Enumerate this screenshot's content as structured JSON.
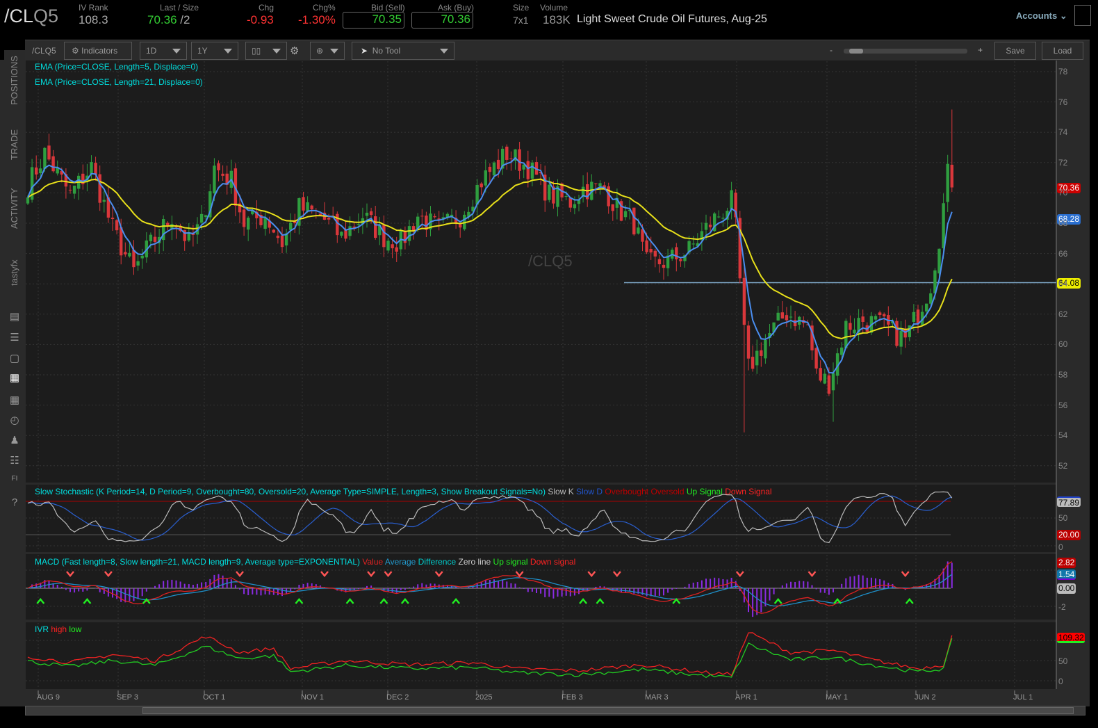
{
  "header": {
    "symbol_main": "/CL",
    "symbol_suffix": "Q5",
    "iv_rank_label": "IV Rank",
    "iv_rank": "108.3",
    "last_label": "Last / Size",
    "last": "70.36",
    "size": "/2",
    "chg_label": "Chg",
    "chg": "-0.93",
    "chgpct_label": "Chg%",
    "chgpct": "-1.30%",
    "bid_label": "Bid (Sell)",
    "bid": "70.35",
    "ask_label": "Ask (Buy)",
    "ask": "70.36",
    "size_label": "Size",
    "size_val": "7x1",
    "volume_label": "Volume",
    "volume": "183K",
    "description": "Light Sweet Crude Oil Futures, Aug-25",
    "accounts": "Accounts"
  },
  "sidebar": {
    "tabs": [
      "POSITIONS",
      "TRADE",
      "ACTIVITY",
      "tastyfx"
    ],
    "icons": [
      "news-icon",
      "list-icon",
      "tv-icon",
      "chart-icon",
      "grid-icon",
      "clock-icon",
      "community-icon",
      "calendar-icon",
      "fi-icon",
      "help-icon"
    ]
  },
  "toolbar": {
    "symbol": "/CLQ5",
    "indicators": "Indicators",
    "interval": "1D",
    "range": "1Y",
    "tool": "No Tool",
    "minus": "-",
    "plus": "+",
    "save": "Save",
    "load": "Load"
  },
  "studies": {
    "ema5": "EMA (Price=CLOSE, Length=5, Displace=0)",
    "ema21": "EMA (Price=CLOSE, Length=21, Displace=0)",
    "watermark": "/CLQ5",
    "stoch": "Slow Stochastic (K Period=14, D Period=9, Overbought=80, Oversold=20, Average Type=SIMPLE, Length=3, Show Breakout Signals=No)",
    "stoch_legend": [
      "Slow K",
      "Slow D",
      "Overbought",
      "Oversold",
      "Up Signal",
      "Down Signal"
    ],
    "macd": "MACD (Fast length=8, Slow length=21, MACD length=9, Average type=EXPONENTIAL)",
    "macd_legend": [
      "Value",
      "Average",
      "Difference",
      "Zero line",
      "Up signal",
      "Down signal"
    ],
    "ivr": "IVR",
    "ivr_legend": [
      "high",
      "low"
    ]
  },
  "colors": {
    "up": "#2f9e3f",
    "down": "#d9373b",
    "ema5": "#4a8ef0",
    "ema21": "#e8e01a"
  },
  "chart_data": {
    "type": "candlestick",
    "price_axis": {
      "ticks": [
        "78",
        "76",
        "74",
        "72",
        "70",
        "68",
        "66",
        "64",
        "62",
        "60",
        "58",
        "56",
        "54",
        "52"
      ],
      "range": [
        52,
        78
      ]
    },
    "x_ticks": [
      "AUG 9",
      "SEP 3",
      "OCT 1",
      "NOV 1",
      "DEC 2",
      "2025",
      "FEB 3",
      "MAR 3",
      "APR 1",
      "MAY 1",
      "JUN 2",
      "JUL 1"
    ],
    "bars": 219,
    "close_anchors": [
      [
        0,
        70.5
      ],
      [
        4,
        72.6
      ],
      [
        10,
        69.9
      ],
      [
        15,
        71.7
      ],
      [
        20,
        67.6
      ],
      [
        25,
        64.8
      ],
      [
        28,
        66.2
      ],
      [
        34,
        68.5
      ],
      [
        38,
        66.7
      ],
      [
        41,
        68
      ],
      [
        44,
        71.7
      ],
      [
        48,
        70.8
      ],
      [
        51,
        68
      ],
      [
        56,
        68.5
      ],
      [
        60,
        66.7
      ],
      [
        64,
        69
      ],
      [
        69,
        68.5
      ],
      [
        74,
        67.1
      ],
      [
        79,
        68.5
      ],
      [
        84,
        67.1
      ],
      [
        88,
        66.7
      ],
      [
        92,
        68.5
      ],
      [
        97,
        67.6
      ],
      [
        102,
        68.5
      ],
      [
        107,
        70.8
      ],
      [
        113,
        72.6
      ],
      [
        118,
        71.7
      ],
      [
        123,
        69.9
      ],
      [
        128,
        69.4
      ],
      [
        131,
        70.3
      ],
      [
        136,
        70.3
      ],
      [
        139,
        69
      ],
      [
        143,
        68
      ],
      [
        146,
        65.3
      ],
      [
        151,
        65.5
      ],
      [
        156,
        66.2
      ],
      [
        161,
        68
      ],
      [
        166,
        69.4
      ],
      [
        167,
        67.6
      ],
      [
        169,
        60.7
      ],
      [
        170,
        58.4
      ],
      [
        174,
        60.3
      ],
      [
        179,
        62.1
      ],
      [
        184,
        61.2
      ],
      [
        186,
        58
      ],
      [
        189,
        57.5
      ],
      [
        193,
        61.2
      ],
      [
        197,
        61.6
      ],
      [
        202,
        61.2
      ],
      [
        207,
        60.3
      ],
      [
        210,
        62.1
      ],
      [
        213,
        64
      ],
      [
        215,
        67.1
      ],
      [
        217,
        71.2
      ],
      [
        218,
        70.36
      ]
    ],
    "hline": 64.08,
    "price_tags": {
      "last": "70.36",
      "ema5": "68.28",
      "level": "64.08"
    },
    "stoch_axis": [
      "50",
      "0"
    ],
    "stoch_tags": {
      "k": "77.89",
      "oversold": "20.00"
    },
    "macd_axis": [
      "-2"
    ],
    "macd_tags": {
      "value": "2.82",
      "avg": "1.54",
      "zero": "0.00"
    },
    "macd_down_signals": [
      10,
      19,
      50,
      70,
      81,
      85,
      97,
      116,
      133,
      139,
      168,
      185,
      207
    ],
    "macd_up_signals": [
      3,
      14,
      28,
      64,
      76,
      84,
      89,
      101,
      131,
      135,
      153,
      177,
      191,
      208
    ],
    "ivr_axis": [
      "50",
      "0"
    ],
    "ivr_tag": "109.32",
    "ivr_high_anchors": [
      [
        0,
        60
      ],
      [
        10,
        45
      ],
      [
        20,
        65
      ],
      [
        30,
        50
      ],
      [
        42,
        110
      ],
      [
        50,
        70
      ],
      [
        58,
        80
      ],
      [
        62,
        30
      ],
      [
        75,
        50
      ],
      [
        90,
        40
      ],
      [
        105,
        45
      ],
      [
        115,
        30
      ],
      [
        130,
        25
      ],
      [
        145,
        40
      ],
      [
        160,
        20
      ],
      [
        166,
        15
      ],
      [
        170,
        120
      ],
      [
        180,
        70
      ],
      [
        190,
        75
      ],
      [
        200,
        50
      ],
      [
        210,
        30
      ],
      [
        216,
        40
      ],
      [
        218,
        112
      ]
    ],
    "ivr_low_anchors": [
      [
        0,
        48
      ],
      [
        10,
        35
      ],
      [
        20,
        50
      ],
      [
        30,
        38
      ],
      [
        42,
        85
      ],
      [
        50,
        55
      ],
      [
        58,
        62
      ],
      [
        62,
        22
      ],
      [
        75,
        38
      ],
      [
        90,
        30
      ],
      [
        105,
        33
      ],
      [
        115,
        20
      ],
      [
        130,
        15
      ],
      [
        145,
        28
      ],
      [
        160,
        12
      ],
      [
        166,
        8
      ],
      [
        170,
        90
      ],
      [
        180,
        52
      ],
      [
        190,
        58
      ],
      [
        200,
        38
      ],
      [
        210,
        22
      ],
      [
        216,
        30
      ],
      [
        218,
        100
      ]
    ]
  }
}
